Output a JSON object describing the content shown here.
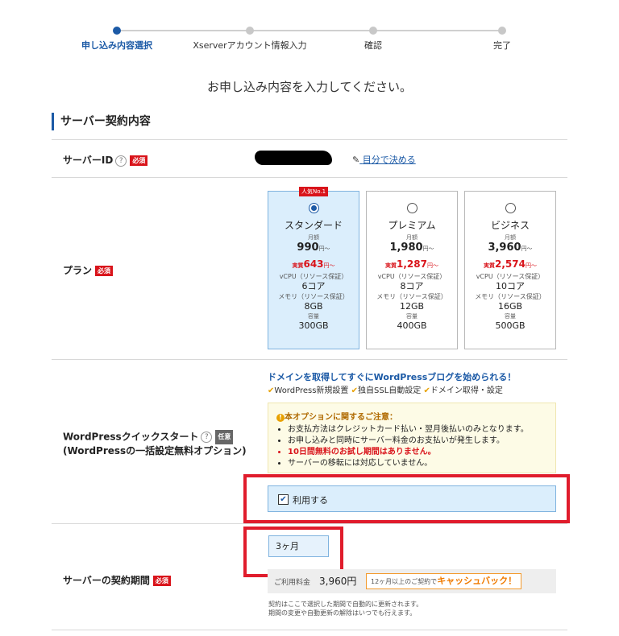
{
  "steps": [
    {
      "label": "申し込み内容選択"
    },
    {
      "label": "Xserverアカウント情報入力"
    },
    {
      "label": "確認"
    },
    {
      "label": "完了"
    }
  ],
  "headline": "お申し込み内容を入力してください。",
  "section_title": "サーバー契約内容",
  "server_id": {
    "label": "サーバーID",
    "help": "?",
    "required": "必須",
    "link": "目分で決める"
  },
  "plan": {
    "label": "プラン",
    "required": "必須",
    "options": [
      {
        "badge": "人気No.1",
        "name": "スタンダード",
        "monthly_label": "月額",
        "price": "990",
        "price_unit": "円〜",
        "real_label": "実質",
        "real_price": "643",
        "real_unit": "円〜",
        "cpu_label": "vCPU（リソース保証）",
        "cpu": "6コア",
        "mem_label": "メモリ（リソース保証）",
        "mem": "8GB",
        "disk_label": "容量",
        "disk": "300GB",
        "selected": true
      },
      {
        "name": "プレミアム",
        "monthly_label": "月額",
        "price": "1,980",
        "price_unit": "円〜",
        "real_label": "実質",
        "real_price": "1,287",
        "real_unit": "円〜",
        "cpu_label": "vCPU（リソース保証）",
        "cpu": "8コア",
        "mem_label": "メモリ（リソース保証）",
        "mem": "12GB",
        "disk_label": "容量",
        "disk": "400GB",
        "selected": false
      },
      {
        "name": "ビジネス",
        "monthly_label": "月額",
        "price": "3,960",
        "price_unit": "円〜",
        "real_label": "実質",
        "real_price": "2,574",
        "real_unit": "円〜",
        "cpu_label": "vCPU（リソース保証）",
        "cpu": "10コア",
        "mem_label": "メモリ（リソース保証）",
        "mem": "16GB",
        "disk_label": "容量",
        "disk": "500GB",
        "selected": false
      }
    ]
  },
  "wordpress": {
    "label": "WordPressクイックスタート",
    "help": "?",
    "optional": "任意",
    "sublabel": "(WordPressの一括設定無料オプション)",
    "headline": "ドメインを取得してすぐにWordPressブログを始められる！",
    "features": [
      "WordPress新規設置",
      "独自SSL自動設定",
      "ドメイン取得・設定"
    ],
    "notice_title": "本オプションに関するご注意：",
    "notice_items": [
      "お支払方法はクレジットカード払い・翌月後払いのみとなります。",
      "お申し込みと同時にサーバー料金のお支払いが発生します。",
      "10日間無料のお試し期間はありません。",
      "サーバーの移転には対応していません。"
    ],
    "use_label": "利用する",
    "checked": true
  },
  "period": {
    "label": "サーバーの契約期間",
    "required": "必須",
    "selected": "3ヶ月",
    "fee_label": "ご利用料金",
    "fee": "3,960円",
    "cashback_text": "12ヶ月以上のご契約で",
    "cashback_em": "キャッシュバック！",
    "note1": "契約はここで選択した期間で自動的に更新されます。",
    "note2": "期間の変更や自動更新の解除はいつでも行えます。"
  },
  "colors": {
    "accent": "#1c5aa6",
    "required": "#d9141b",
    "highlight": "#e01c2c"
  }
}
